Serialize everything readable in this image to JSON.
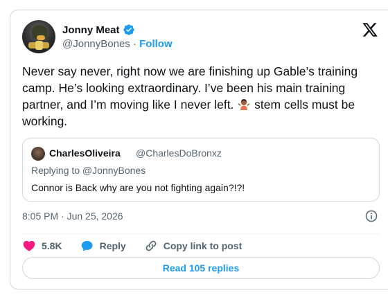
{
  "author": {
    "name": "Jonny Meat",
    "handle": "@JonnyBones",
    "separator": " · ",
    "follow_label": "Follow"
  },
  "tweet": {
    "text": "Never say never, right now we are finishing up Gable’s training camp. He’s looking extraordinary. I’ve been his main training partner, and I’m moving like I never left. ",
    "text_after_emoji": " stem cells must be working.",
    "emoji": "person-shrugging-emoji",
    "timestamp": "8:05 PM · Jun 25, 2026"
  },
  "quote": {
    "name": "CharlesOliveira",
    "handle": "@CharlesDoBronxz",
    "replying_to": "Replying to @JonnyBones",
    "text": "Connor is Back why are you not fighting again?!?!"
  },
  "actions": {
    "likes_count": "5.8K",
    "reply_label": "Reply",
    "copy_link_label": "Copy link to post"
  },
  "read_replies_label": "Read 105 replies",
  "colors": {
    "accent": "#1d9bf0",
    "like": "#f91880",
    "secondary_text": "#536471",
    "border": "#cfd9de"
  }
}
